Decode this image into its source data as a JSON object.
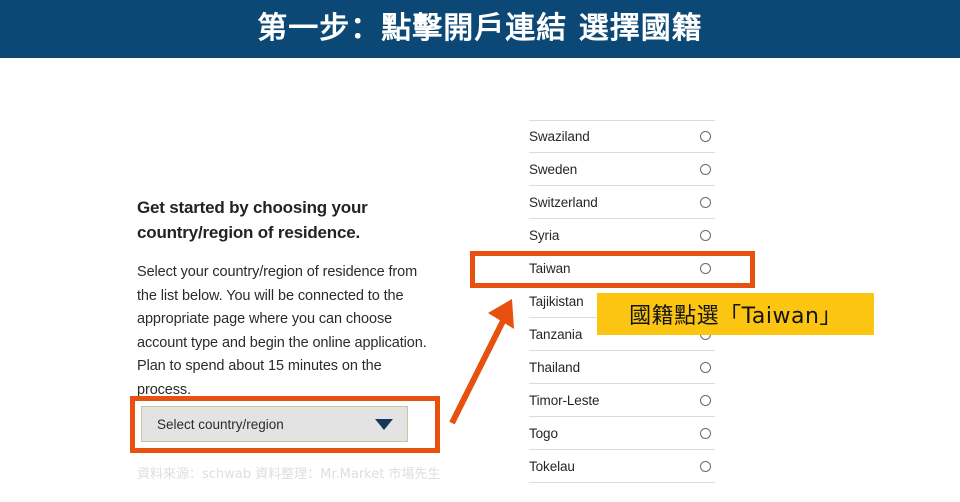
{
  "header": {
    "title": "第一步：點擊開戶連結 選擇國籍",
    "background_color": "#0b4876",
    "text_color": "#ffffff"
  },
  "left_panel": {
    "heading": "Get started by choosing your country/region of residence.",
    "body": "Select your country/region of residence from the list below. You will be connected to the appropriate page where you can choose account type and begin the online application. Plan to spend about 15 minutes on the process.",
    "select": {
      "value": "Select country/region",
      "placeholder": "Select country/region",
      "caret_icon": "chevron-down-icon",
      "background_color": "#e3e3e3",
      "border_color": "#c9c49a"
    }
  },
  "country_list": {
    "rows": [
      {
        "name": "Swaziland",
        "selected": false
      },
      {
        "name": "Sweden",
        "selected": false
      },
      {
        "name": "Switzerland",
        "selected": false
      },
      {
        "name": "Syria",
        "selected": false
      },
      {
        "name": "Taiwan",
        "selected": false
      },
      {
        "name": "Tajikistan",
        "selected": false
      },
      {
        "name": "Tanzania",
        "selected": false
      },
      {
        "name": "Thailand",
        "selected": false
      },
      {
        "name": "Timor-Leste",
        "selected": false
      },
      {
        "name": "Togo",
        "selected": false
      },
      {
        "name": "Tokelau",
        "selected": false
      }
    ],
    "radio_icon": "radio-button-unchecked-icon"
  },
  "annotations": {
    "highlight_color": "#e8500f",
    "arrow_icon": "arrow-up-right-icon",
    "select_highlight_target": "Select country/region",
    "row_highlight_target": "Taiwan",
    "callout": {
      "text": "國籍點選「Taiwan」",
      "background_color": "#fcc511",
      "text_color": "#141414"
    }
  },
  "footer": {
    "credit": "資料來源：schwab  資料整理：Mr.Market 市場先生",
    "text_color": "#dedede"
  }
}
